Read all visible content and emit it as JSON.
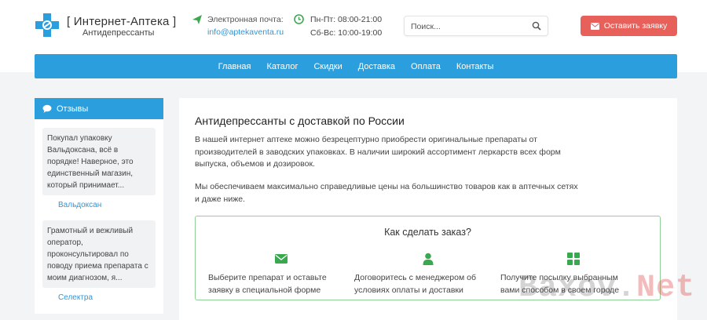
{
  "header": {
    "logo_title": "[ Интернет-Аптека ]",
    "logo_subtitle": "Антидепрессанты",
    "email_label": "Электронная почта:",
    "email_value": "info@aptekaventa.ru",
    "hours_weekdays": "Пн-Пт: 08:00-21:00",
    "hours_weekend": "Сб-Вс: 10:00-19:00",
    "search_placeholder": "Поиск...",
    "order_button": "Оставить заявку"
  },
  "nav": {
    "items": [
      "Главная",
      "Каталог",
      "Скидки",
      "Доставка",
      "Оплата",
      "Контакты"
    ]
  },
  "sidebar": {
    "title": "Отзывы",
    "reviews": [
      {
        "text": "Покупал упаковку Вальдоксана, всё в порядке! Наверное, это единственный магазин, который принимает...",
        "product": "Вальдоксан"
      },
      {
        "text": "Грамотный и вежливый оператор, проконсультировал по поводу приема препарата с моим диагнозом, я...",
        "product": "Селектра"
      }
    ]
  },
  "main": {
    "title": "Антидепрессанты с доставкой по России",
    "paragraph1": "В нашей интернет аптеке можно безрецептурно приобрести оригинальные препараты от производителей в заводских упаковках. В наличии широкий ассортимент леркарств всех форм выпуска, объемов и дозировок.",
    "paragraph2": "Мы обеспечиваем максимально справедливые цены на большинство товаров как в аптечных сетях и даже ниже.",
    "how_to_order": {
      "title": "Как сделать заказ?",
      "steps": [
        {
          "icon": "envelope-icon",
          "text": "Выберите препарат и оставьте заявку в специальной форме"
        },
        {
          "icon": "user-icon",
          "text": "Договоритесь с менеджером об условиях оплаты и доставки"
        },
        {
          "icon": "grid-icon",
          "text": "Получите посылку выбранным вами способом в своем городе"
        }
      ]
    }
  },
  "watermark": {
    "part1": "Baxov.",
    "part2": "Net"
  },
  "colors": {
    "accent_blue": "#2b9ede",
    "order_red": "#e8605a",
    "green": "#3aa84f"
  }
}
